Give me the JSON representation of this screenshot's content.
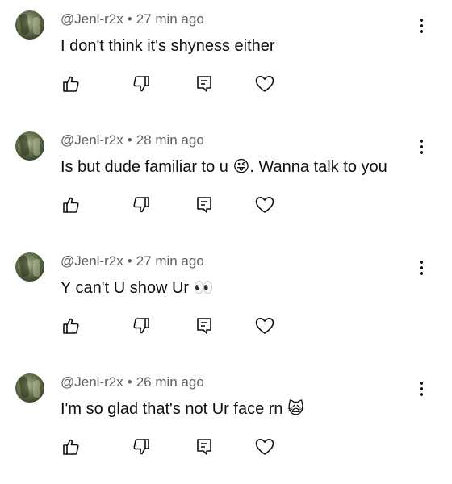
{
  "comments": [
    {
      "author": "@Jenl-r2x",
      "separator": "•",
      "time": "27 min ago",
      "text": "I don't think it's shyness either",
      "emoji": "",
      "text_after": ""
    },
    {
      "author": "@Jenl-r2x",
      "separator": "•",
      "time": "28 min ago",
      "text": "Is but dude familiar to u ",
      "emoji": "😜",
      "text_after": ". Wanna talk to you"
    },
    {
      "author": "@Jenl-r2x",
      "separator": "•",
      "time": "27 min ago",
      "text": "Y can't U show Ur ",
      "emoji": "👀",
      "text_after": ""
    },
    {
      "author": "@Jenl-r2x",
      "separator": "•",
      "time": "26 min ago",
      "text": "I'm so glad that's not Ur face rn ",
      "emoji": "🙀",
      "text_after": ""
    }
  ],
  "icons": {
    "like": "thumbs-up-icon",
    "dislike": "thumbs-down-icon",
    "reply": "reply-icon",
    "heart": "heart-icon",
    "menu": "more-vertical-icon"
  },
  "colors": {
    "meta_text": "#606060",
    "body_text": "#0f0f0f",
    "icon": "#0f0f0f"
  }
}
